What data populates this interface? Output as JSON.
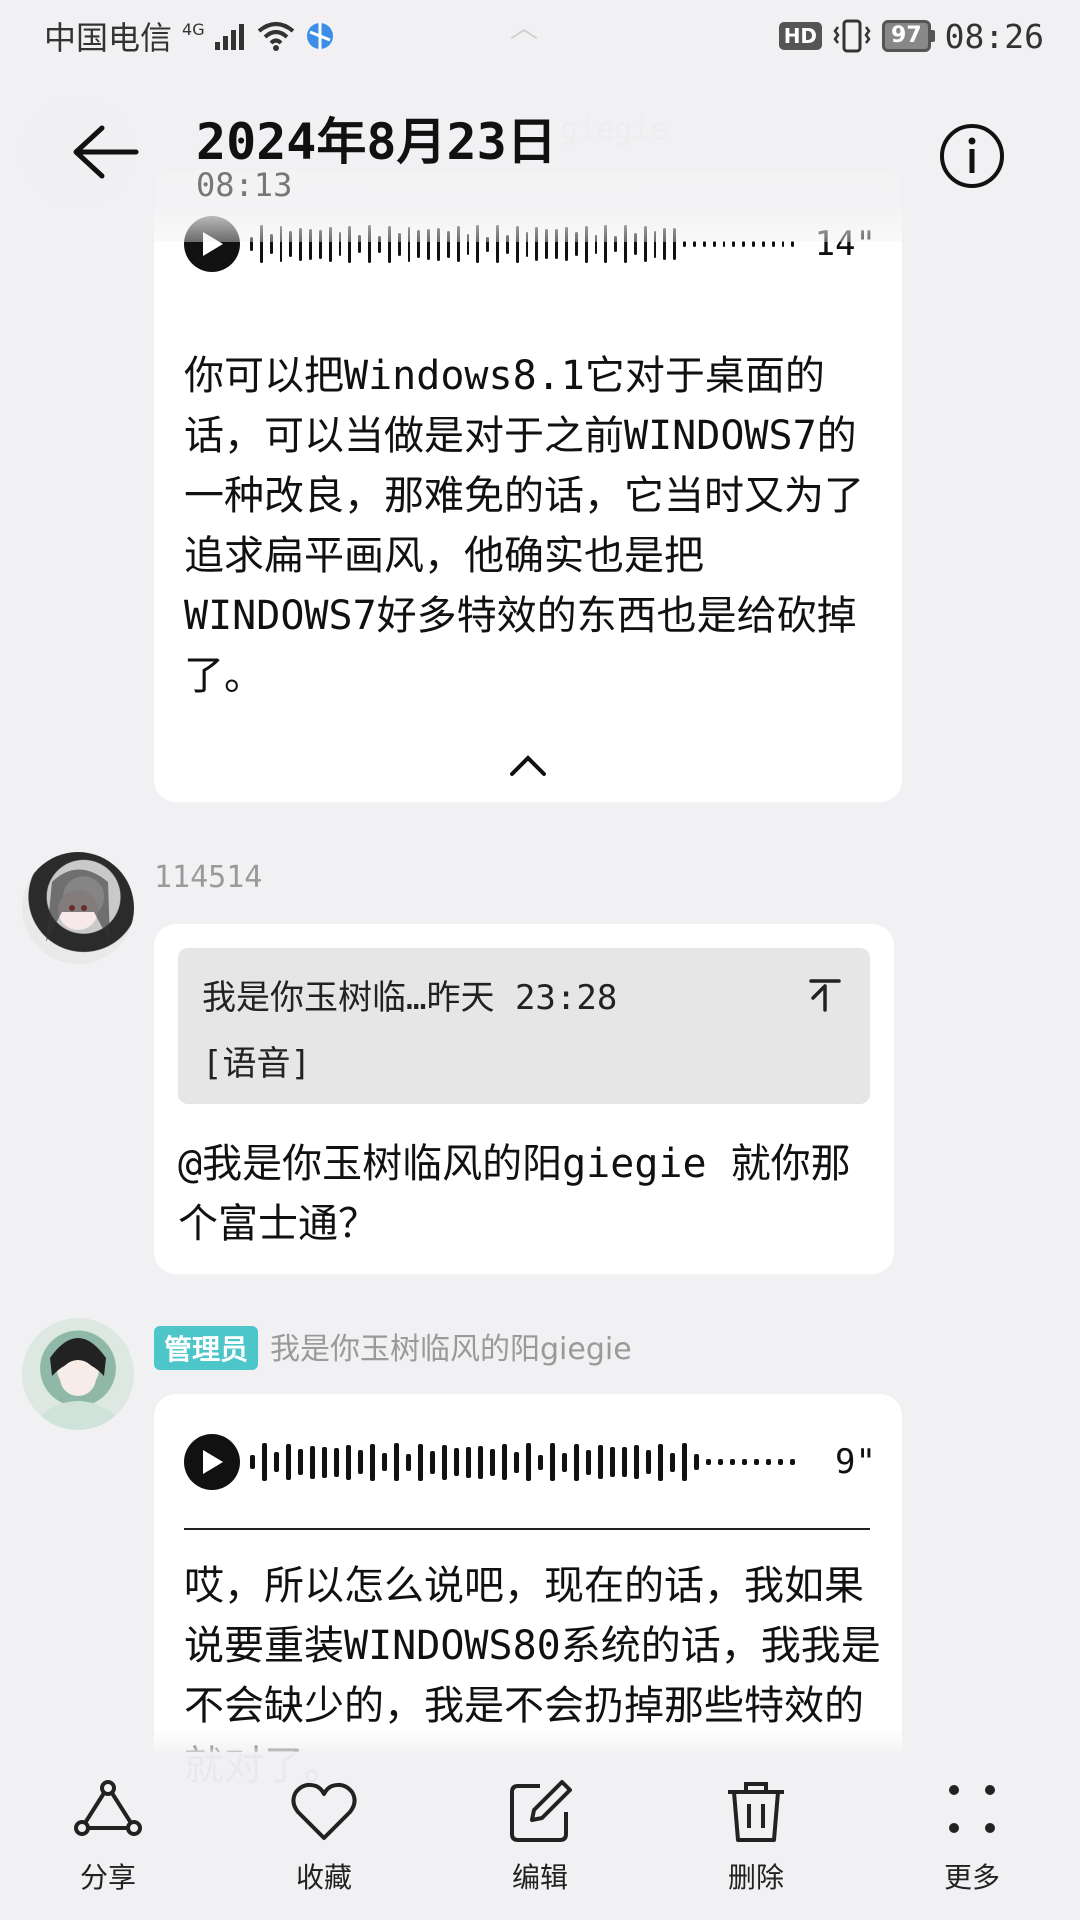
{
  "status_bar": {
    "carrier": "中国电信",
    "network": "4G",
    "hd": "HD",
    "battery": "97",
    "time": "08:26"
  },
  "header": {
    "title": "2024年8月23日",
    "subtitle": "08:13"
  },
  "ghost": {
    "name": "giegie"
  },
  "messages": [
    {
      "duration": "14\"",
      "text": "你可以把Windows8.1它对于桌面的话，可以当做是对于之前WINDOWS7的一种改良，那难免的话，它当时又为了追求扁平画风，他确实也是把WINDOWS7好多特效的东西也是给砍掉了。"
    },
    {
      "sender": "114514",
      "quote_line1": "我是你玉树临…昨天 23:28",
      "quote_line2": "[语音]",
      "text": "@我是你玉树临风的阳giegie 就你那个富士通？"
    },
    {
      "badge": "管理员",
      "sender": "我是你玉树临风的阳giegie",
      "duration": "9\"",
      "text": "哎，所以怎么说吧，现在的话，我如果说要重装WINDOWS80系统的话，我我是不会缺少的，我是不会扔掉那些特效的就对了。"
    }
  ],
  "toolbar": {
    "share": "分享",
    "favorite": "收藏",
    "edit": "编辑",
    "delete": "删除",
    "more": "更多"
  },
  "colors": {
    "background": "#f1f1f3",
    "bubble": "#ffffff",
    "admin_badge": "#4cc6c8",
    "quote_bg": "#e6e6e6"
  }
}
